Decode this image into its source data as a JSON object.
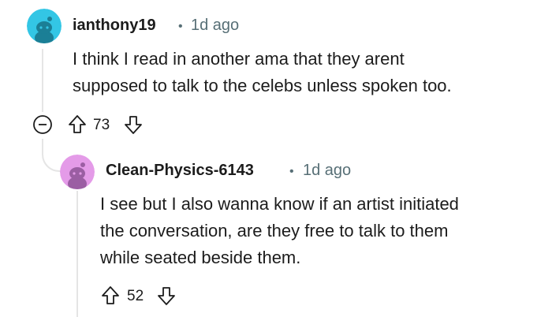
{
  "comments": [
    {
      "username": "ianthony19",
      "separator": "•",
      "time": "1d ago",
      "text_lines": [
        "I think I read in another ama that they arent",
        "supposed to talk to the celebs unless spoken too."
      ],
      "score": "73",
      "avatar_color": "#33c6e5"
    },
    {
      "username": "Clean-Physics-6143",
      "separator": "•",
      "time": "1d ago",
      "text_lines": [
        "I see but I also wanna know if an artist initiated",
        "the conversation, are they free to talk to them",
        "while seated beside them."
      ],
      "score": "52",
      "avatar_color": "#e49be8"
    }
  ],
  "icons": {
    "collapse": "collapse-minus-icon",
    "upvote": "upvote-arrow-icon",
    "downvote": "downvote-arrow-icon"
  }
}
